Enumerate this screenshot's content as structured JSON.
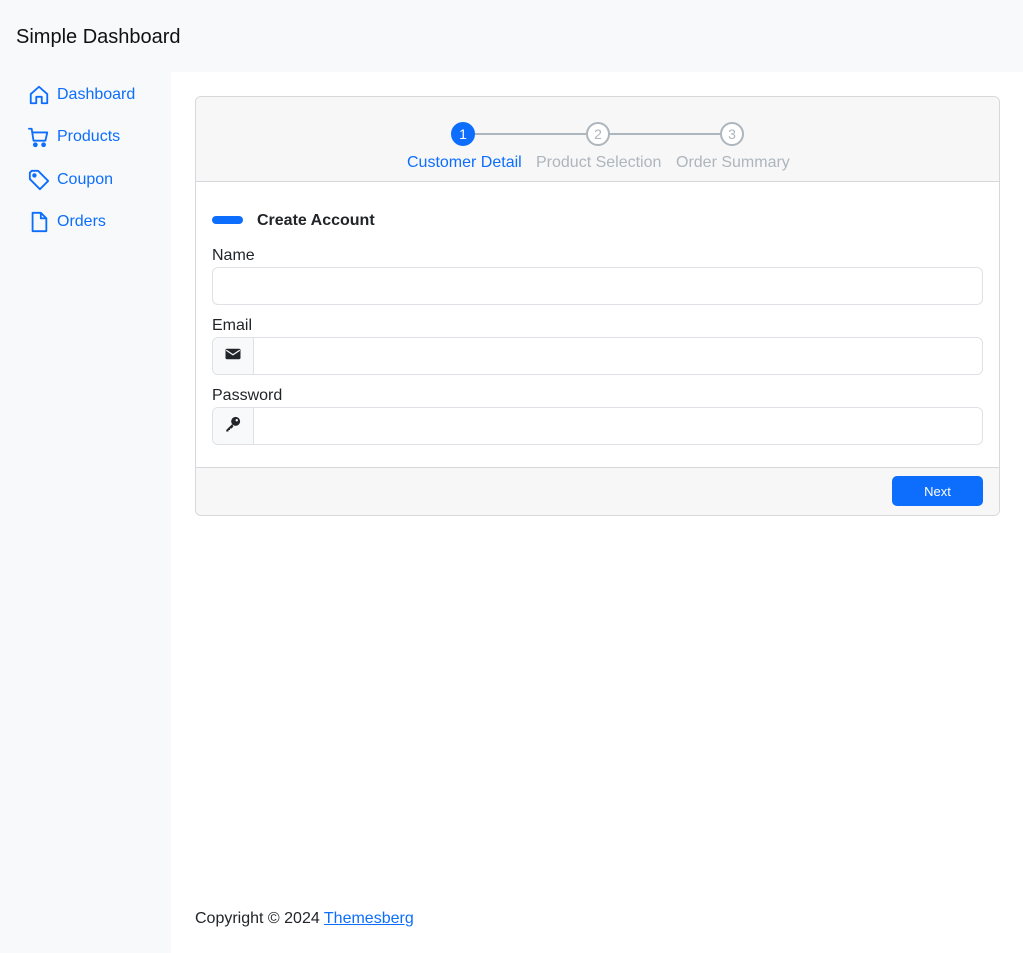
{
  "app": {
    "title": "Simple Dashboard"
  },
  "sidebar": {
    "items": [
      {
        "label": "Dashboard",
        "icon": "home-icon"
      },
      {
        "label": "Products",
        "icon": "cart-icon"
      },
      {
        "label": "Coupon",
        "icon": "tag-icon"
      },
      {
        "label": "Orders",
        "icon": "file-icon"
      }
    ]
  },
  "stepper": {
    "steps": [
      {
        "number": "1",
        "label": "Customer Detail",
        "state": "active"
      },
      {
        "number": "2",
        "label": "Product Selection",
        "state": "inactive"
      },
      {
        "number": "3",
        "label": "Order Summary",
        "state": "inactive"
      }
    ]
  },
  "form": {
    "title": "Create Account",
    "fields": [
      {
        "label": "Name",
        "value": "",
        "icon": ""
      },
      {
        "label": "Email",
        "value": "",
        "icon": "envelope-icon"
      },
      {
        "label": "Password",
        "value": "",
        "icon": "key-icon"
      }
    ],
    "next_label": "Next"
  },
  "footer": {
    "text": "Copyright © 2024",
    "link": "Themesberg"
  },
  "colors": {
    "accent": "#0d6efd",
    "muted": "#adb5bd",
    "sidebar_bg": "#f8f9fa"
  }
}
